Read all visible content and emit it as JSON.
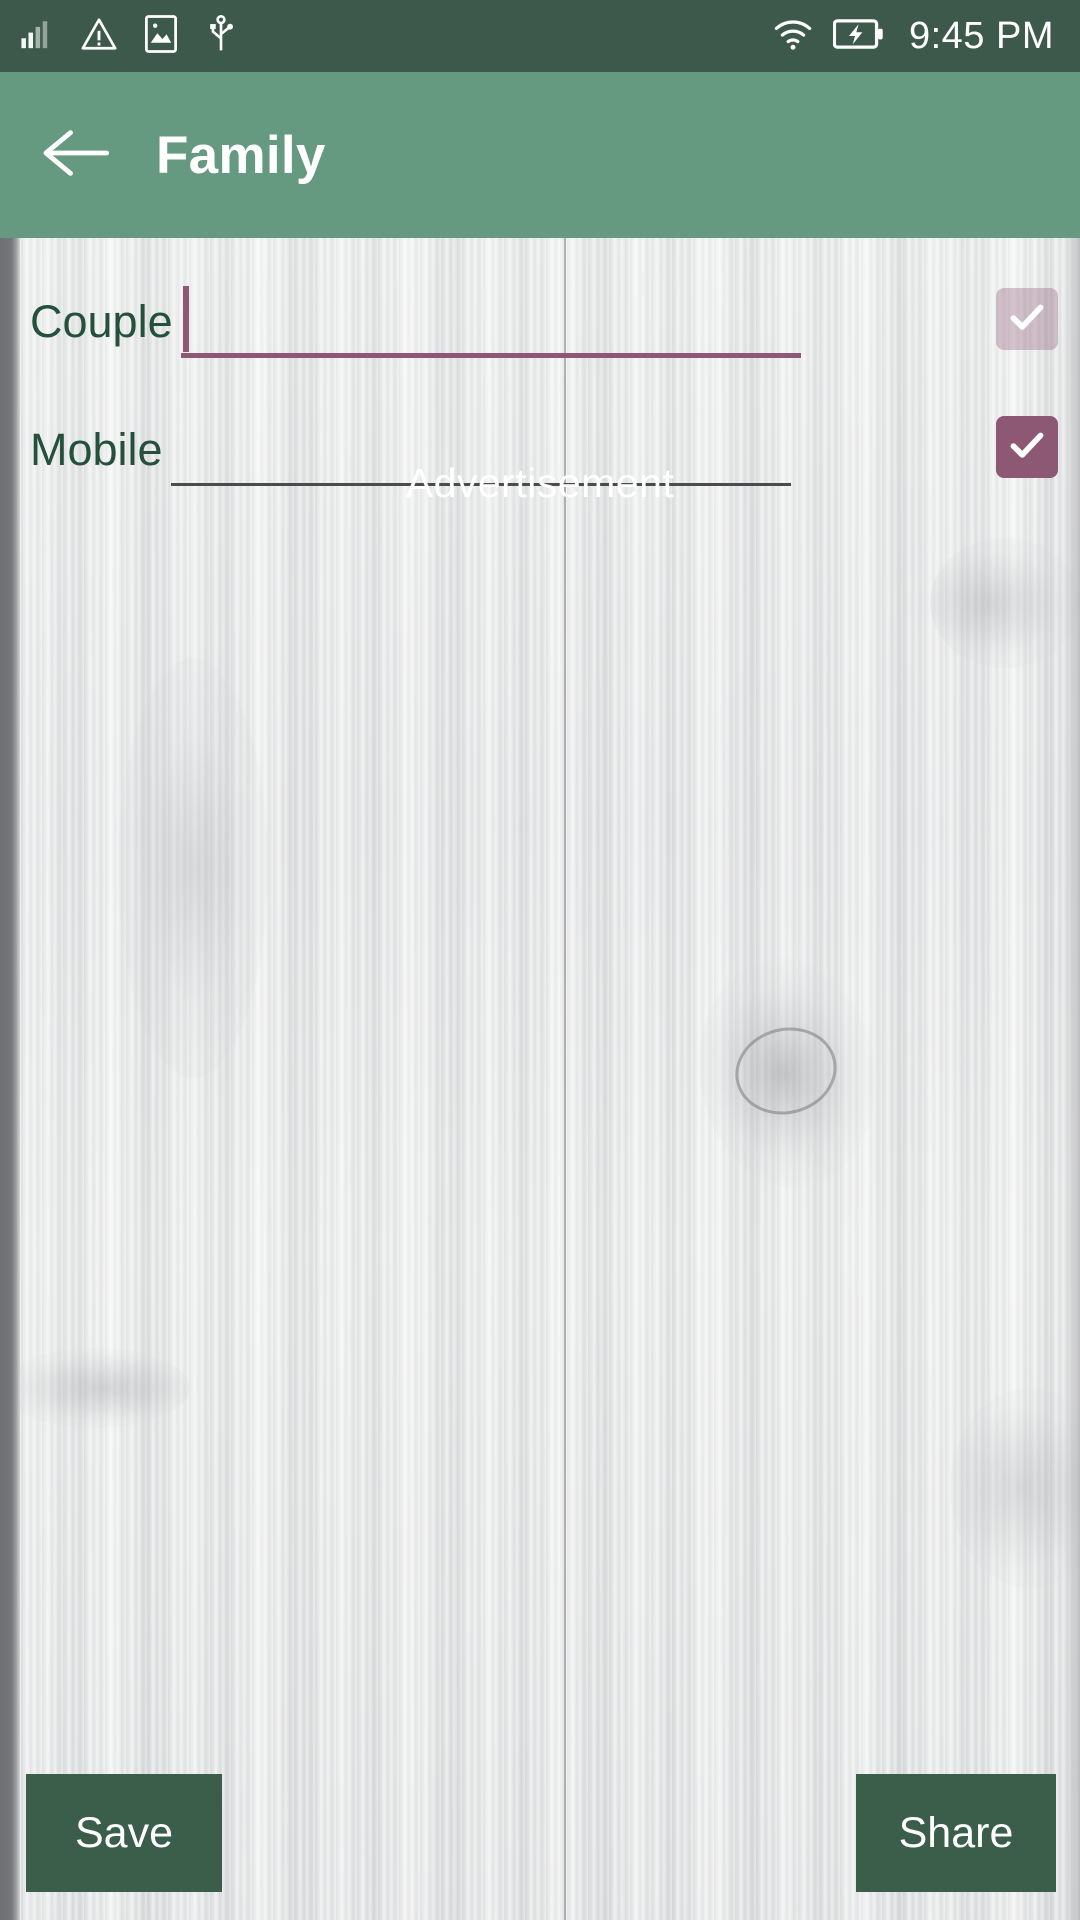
{
  "status_bar": {
    "time": "9:45 PM",
    "icons": [
      "signal-bars-icon",
      "warning-triangle-icon",
      "image-icon",
      "usb-icon",
      "wifi-icon",
      "battery-charging-icon"
    ],
    "background_color": "#3d594b"
  },
  "app_bar": {
    "back_label": "back-arrow",
    "title": "Family",
    "background_color": "#659980"
  },
  "form": {
    "fields": [
      {
        "label": "Couple",
        "value": "",
        "placeholder": "",
        "focused": true,
        "checkbox_checked": true,
        "checkbox_style": "faded",
        "underline_color": "#8d5873"
      },
      {
        "label": "Mobile",
        "value": "",
        "placeholder": "",
        "focused": false,
        "checkbox_checked": true,
        "checkbox_style": "solid",
        "underline_color": "#4b4b4b"
      }
    ]
  },
  "advertisement": {
    "label": "Advertisement"
  },
  "actions": {
    "save_label": "Save",
    "share_label": "Share",
    "button_color": "#3a5e49"
  },
  "theme": {
    "accent_green": "#659980",
    "dark_green": "#3d594b",
    "label_green": "#24503c",
    "accent_maroon": "#8d5873"
  }
}
